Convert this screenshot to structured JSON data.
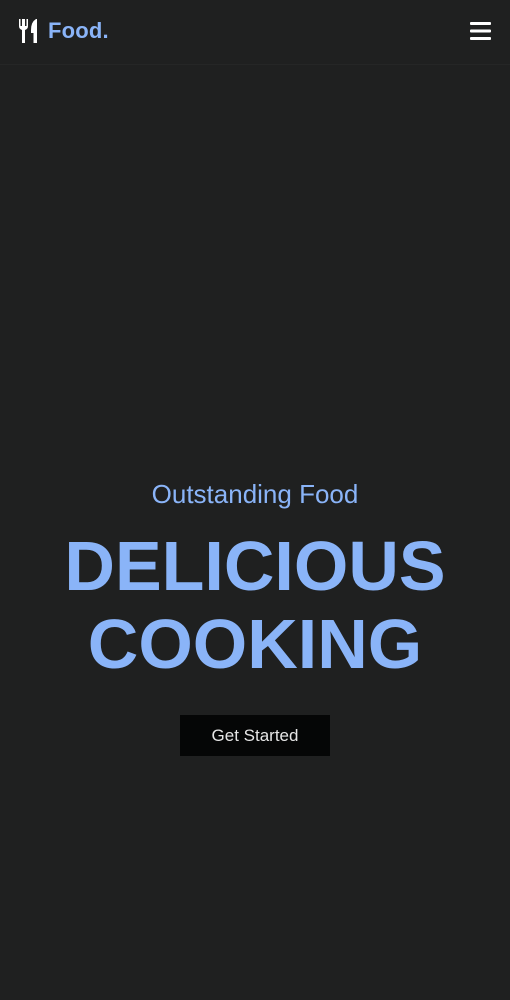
{
  "header": {
    "logo_text": "Food.",
    "logo_icon": "fork-knife-icon",
    "menu_icon": "hamburger-menu-icon"
  },
  "hero": {
    "subtitle": "Outstanding Food",
    "headline_line1": "DELICIOUS",
    "headline_line2": "COOKING",
    "cta_label": "Get Started"
  },
  "colors": {
    "background": "#1f2020",
    "accent": "#8ab4f8",
    "button_bg": "#050606",
    "button_text": "#e6e6e6"
  }
}
